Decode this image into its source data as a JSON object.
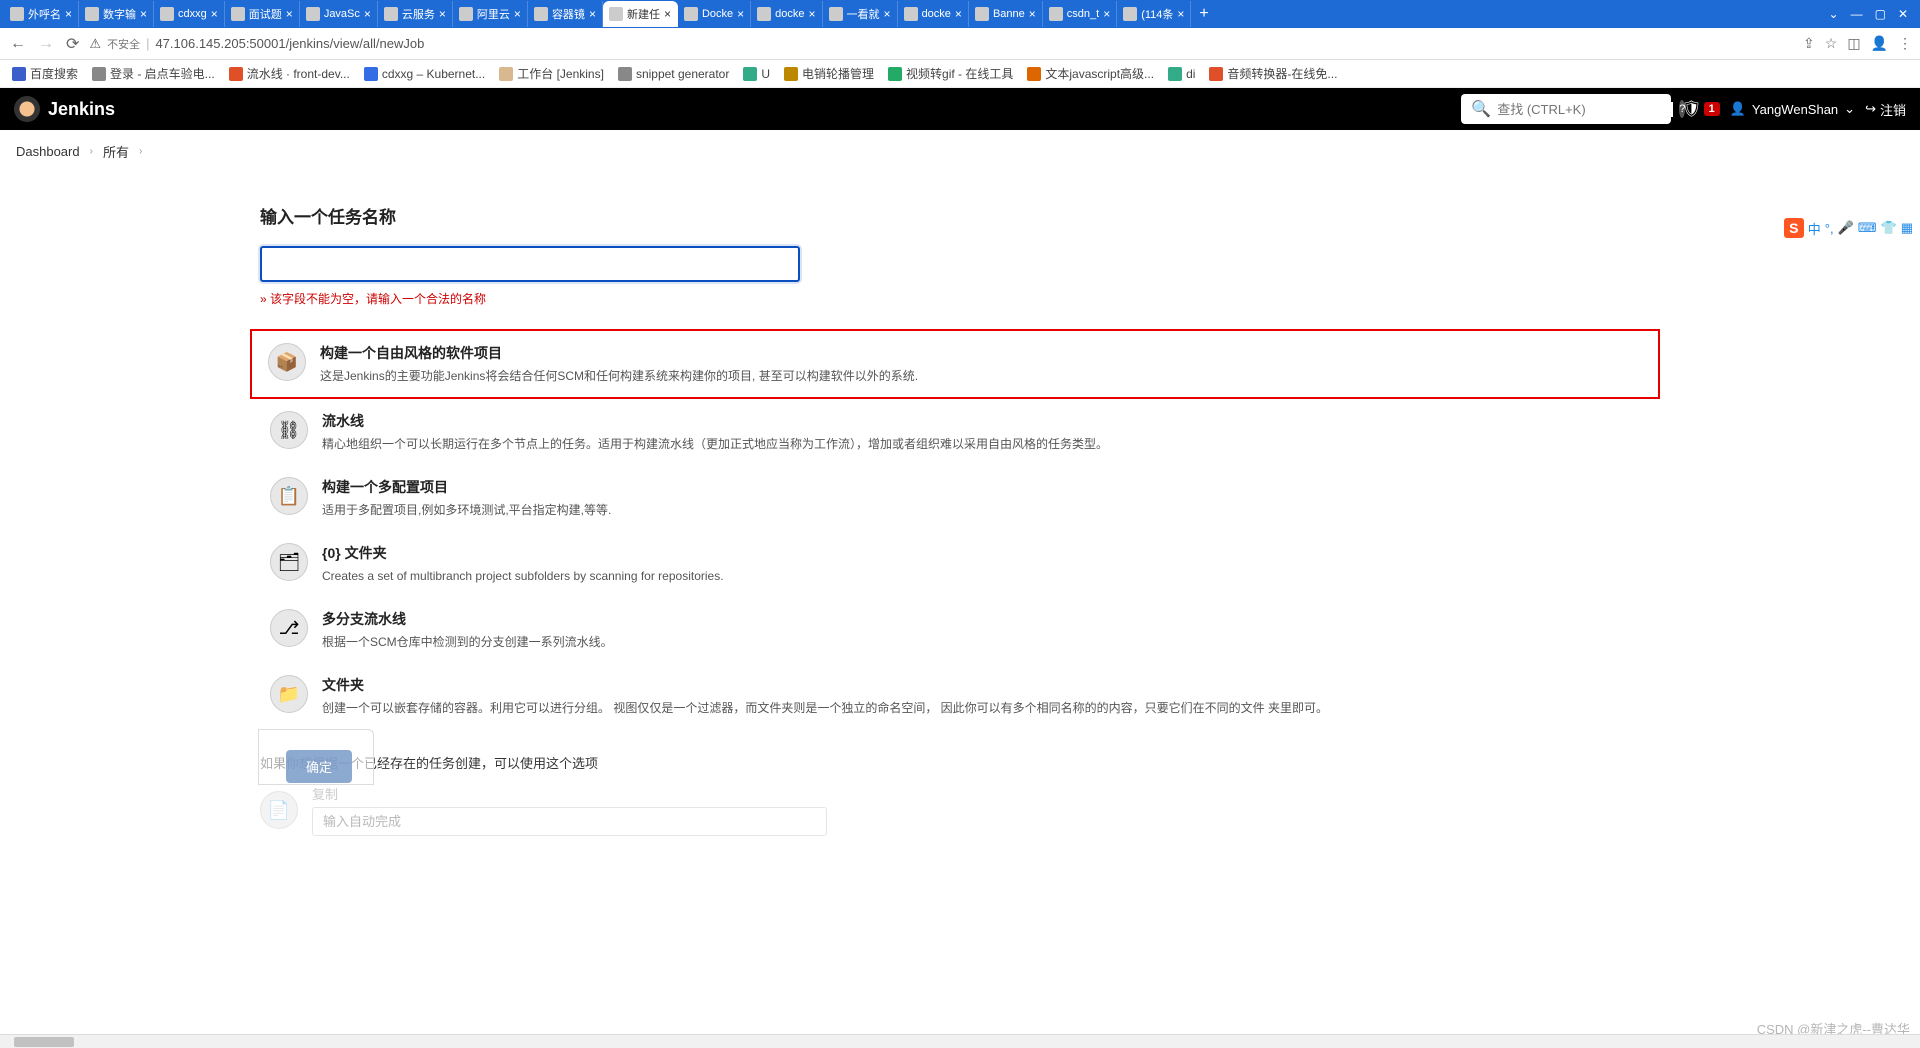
{
  "browser": {
    "tabs": [
      {
        "label": "外呼名",
        "active": false
      },
      {
        "label": "数字输",
        "active": false
      },
      {
        "label": "cdxxg",
        "active": false
      },
      {
        "label": "面试题",
        "active": false
      },
      {
        "label": "JavaSc",
        "active": false
      },
      {
        "label": "云服务",
        "active": false
      },
      {
        "label": "阿里云",
        "active": false
      },
      {
        "label": "容器镜",
        "active": false
      },
      {
        "label": "新建任",
        "active": true
      },
      {
        "label": "Docke",
        "active": false
      },
      {
        "label": "docke",
        "active": false
      },
      {
        "label": "一看就",
        "active": false
      },
      {
        "label": "docke",
        "active": false
      },
      {
        "label": "Banne",
        "active": false
      },
      {
        "label": "csdn_t",
        "active": false
      },
      {
        "label": "(114条",
        "active": false
      }
    ],
    "url_secure": "不安全",
    "url": "47.106.145.205:50001/jenkins/view/all/newJob",
    "bookmarks": [
      {
        "label": "百度搜索",
        "color": "#3b5fca"
      },
      {
        "label": "登录 - 启点车验电...",
        "color": "#888"
      },
      {
        "label": "流水线 · front-dev...",
        "color": "#e05028"
      },
      {
        "label": "cdxxg – Kubernet...",
        "color": "#326de6"
      },
      {
        "label": "工作台 [Jenkins]",
        "color": "#d8b98f"
      },
      {
        "label": "snippet generator",
        "color": "#888"
      },
      {
        "label": "U",
        "color": "#3a8"
      },
      {
        "label": "电销轮播管理",
        "color": "#b80"
      },
      {
        "label": "视频转gif - 在线工具",
        "color": "#2a6"
      },
      {
        "label": "文本javascript高级...",
        "color": "#d60"
      },
      {
        "label": "di",
        "color": "#3a8"
      },
      {
        "label": "音频转换器-在线免...",
        "color": "#e05028"
      }
    ]
  },
  "jenkins": {
    "title": "Jenkins",
    "search_placeholder": "查找 (CTRL+K)",
    "notif_count": "1",
    "user": "YangWenShan",
    "logout": "注销"
  },
  "crumbs": {
    "dashboard": "Dashboard",
    "all": "所有"
  },
  "form": {
    "heading": "输入一个任务名称",
    "name_value": "",
    "error": "» 该字段不能为空，请输入一个合法的名称",
    "items": [
      {
        "title": "构建一个自由风格的软件项目",
        "desc": "这是Jenkins的主要功能Jenkins将会结合任何SCM和任何构建系统来构建你的项目, 甚至可以构建软件以外的系统.",
        "icon": "📦",
        "highlight": true
      },
      {
        "title": "流水线",
        "desc": "精心地组织一个可以长期运行在多个节点上的任务。适用于构建流水线（更加正式地应当称为工作流），增加或者组织难以采用自由风格的任务类型。",
        "icon": "⛓",
        "highlight": false
      },
      {
        "title": "构建一个多配置项目",
        "desc": "适用于多配置项目,例如多环境测试,平台指定构建,等等.",
        "icon": "📋",
        "highlight": false
      },
      {
        "title": "{0} 文件夹",
        "desc": "Creates a set of multibranch project subfolders by scanning for repositories.",
        "icon": "🗂",
        "highlight": false
      },
      {
        "title": "多分支流水线",
        "desc": "根据一个SCM仓库中检测到的分支创建一系列流水线。",
        "icon": "⎇",
        "highlight": false
      },
      {
        "title": "文件夹",
        "desc": "创建一个可以嵌套存储的容器。利用它可以进行分组。 视图仅仅是一个过滤器，而文件夹则是一个独立的命名空间， 因此你可以有多个相同名称的的内容，只要它们在不同的文件 夹里即可。",
        "icon": "📁",
        "highlight": false
      }
    ],
    "copy_label": "如果你想根据一个已经存在的任务创建，可以使用这个选项",
    "copy_title": "复制",
    "copy_placeholder": "输入自动完成",
    "ok_label": "确定"
  },
  "ime": {
    "logo": "S",
    "lang": "中"
  },
  "watermark": "CSDN @新津之虎--曹达华"
}
